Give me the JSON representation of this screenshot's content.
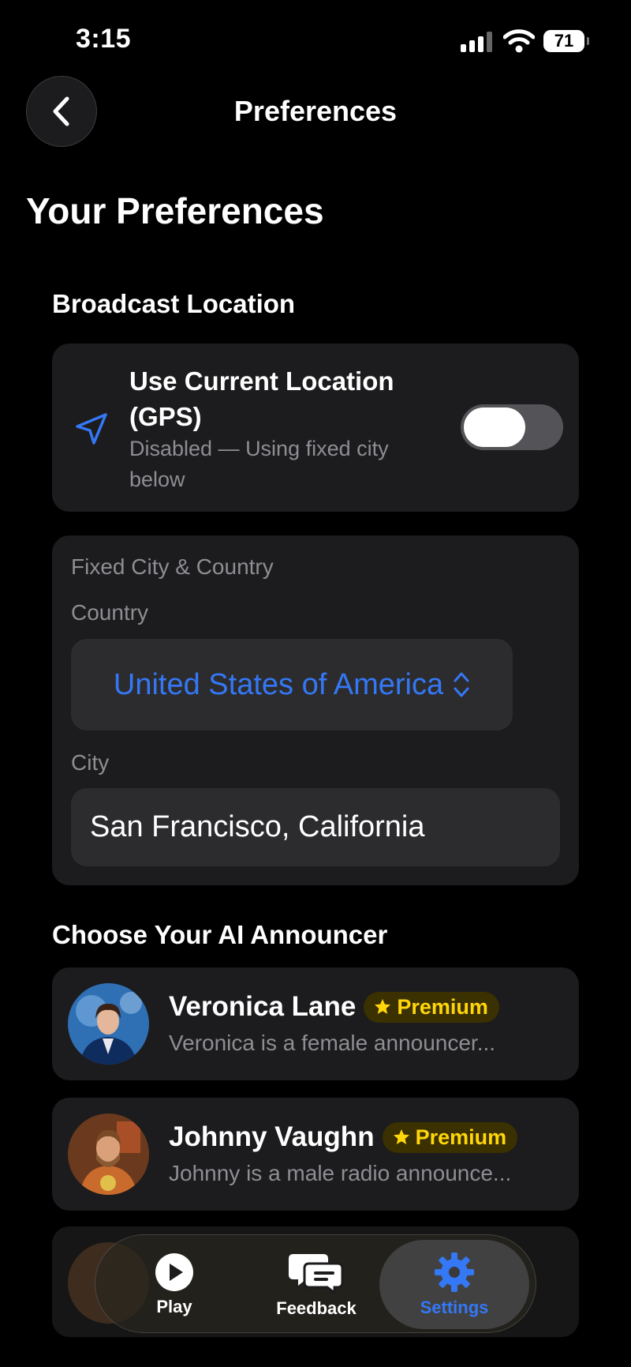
{
  "status_bar": {
    "time": "3:15",
    "battery": "71"
  },
  "nav": {
    "title": "Preferences"
  },
  "page_title": "Your Preferences",
  "broadcast": {
    "section_title": "Broadcast Location",
    "gps_title": "Use Current Location (GPS)",
    "gps_subtitle": "Disabled — Using fixed city below",
    "gps_enabled": false
  },
  "fixed_location": {
    "card_title": "Fixed City & Country",
    "country_label": "Country",
    "country_value": "United States of America",
    "city_label": "City",
    "city_value": "San Francisco, California"
  },
  "announcers": {
    "section_title": "Choose Your AI Announcer",
    "items": [
      {
        "name": "Veronica Lane",
        "badge": "Premium",
        "description": "Veronica is a female announcer..."
      },
      {
        "name": "Johnny Vaughn",
        "badge": "Premium",
        "description": "Johnny is a male radio announce..."
      }
    ]
  },
  "tabbar": {
    "tabs": [
      {
        "label": "Play"
      },
      {
        "label": "Feedback"
      },
      {
        "label": "Settings"
      }
    ],
    "active": "Settings"
  },
  "colors": {
    "accent": "#3478f6",
    "premium": "#ffd60a",
    "card": "#1c1c1e"
  }
}
